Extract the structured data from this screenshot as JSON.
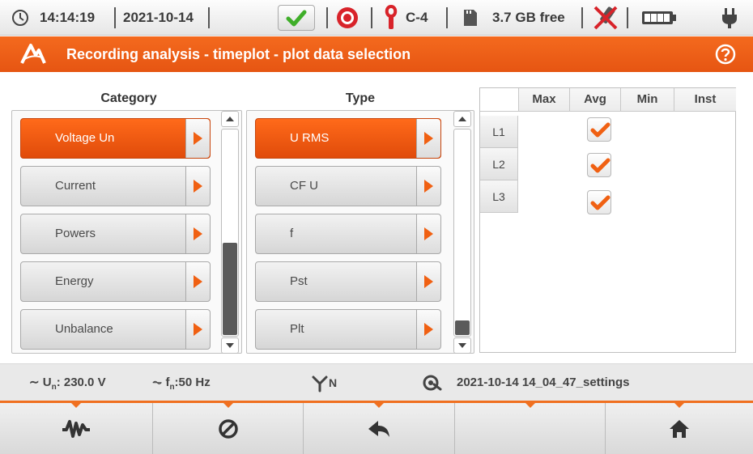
{
  "status": {
    "time": "14:14:19",
    "date": "2021-10-14",
    "clamp": "C-4",
    "memory": "3.7 GB free"
  },
  "title": "Recording analysis - timeplot - plot data selection",
  "category": {
    "header": "Category",
    "items": [
      "Voltage Un",
      "Current",
      "Powers",
      "Energy",
      "Unbalance"
    ],
    "selected": "Voltage Un"
  },
  "type": {
    "header": "Type",
    "items": [
      "U RMS",
      "CF U",
      "f",
      "Pst",
      "Plt"
    ],
    "selected": "U RMS"
  },
  "table": {
    "columns": [
      "Max",
      "Avg",
      "Min",
      "Inst"
    ],
    "rows": [
      {
        "label": "L1",
        "Max": false,
        "Avg": true,
        "Min": false,
        "Inst": false
      },
      {
        "label": "L2",
        "Max": false,
        "Avg": true,
        "Min": false,
        "Inst": false
      },
      {
        "label": "L3",
        "Max": false,
        "Avg": true,
        "Min": false,
        "Inst": false
      }
    ]
  },
  "info": {
    "un_label": "U",
    "un_sub": "n",
    "un_value": ": 230.0 V",
    "fn_label": "f",
    "fn_sub": "n",
    "fn_value": ":50 Hz",
    "network_sub": "N",
    "settings": "2021-10-14 14_04_47_settings"
  },
  "colors": {
    "accent": "#f06012",
    "check_ok": "#3fae29"
  },
  "icons": {
    "clock": "clock-icon",
    "ok": "checkmark-icon",
    "record": "record-icon",
    "clamp": "clamp-icon",
    "sd": "sd-card-icon",
    "usb": "usb-disabled-icon",
    "battery": "battery-icon",
    "plug": "plug-icon",
    "help": "help-icon",
    "waveform": "waveform-icon",
    "cancel": "cancel-icon",
    "back": "back-icon",
    "home": "home-icon"
  }
}
